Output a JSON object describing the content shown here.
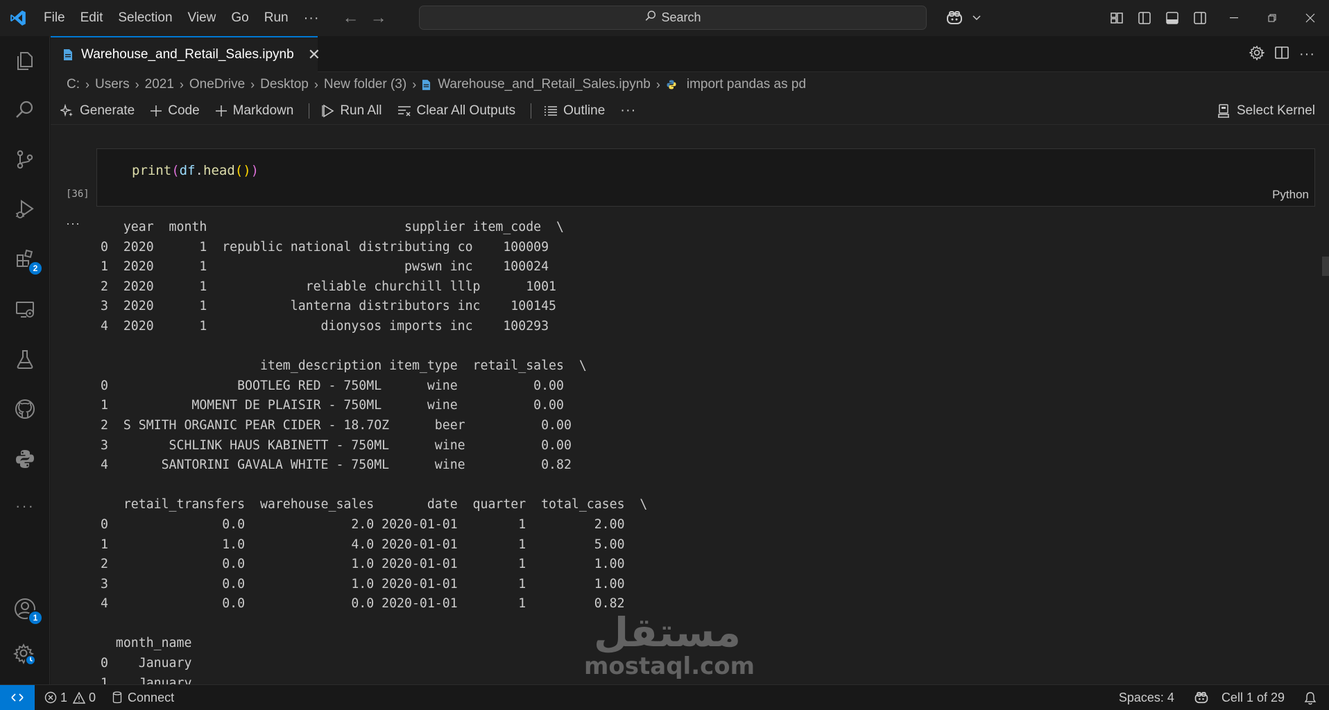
{
  "titlebar": {
    "menus": [
      "File",
      "Edit",
      "Selection",
      "View",
      "Go",
      "Run"
    ],
    "more": "···",
    "back": "←",
    "forward": "→",
    "search_label": "Search"
  },
  "tab": {
    "label": "Warehouse_and_Retail_Sales.ipynb",
    "close": "✕"
  },
  "breadcrumb": [
    "C:",
    "Users",
    "2021",
    "OneDrive",
    "Desktop",
    "New folder (3)",
    "Warehouse_and_Retail_Sales.ipynb",
    "import pandas as pd"
  ],
  "toolbar": {
    "generate": "Generate",
    "code": "Code",
    "markdown": "Markdown",
    "run_all": "Run All",
    "clear_outputs": "Clear All Outputs",
    "outline": "Outline",
    "more": "···",
    "select_kernel": "Select Kernel"
  },
  "cell": {
    "code": {
      "fn": "print",
      "p1": "(",
      "var": "df",
      "dot": ".",
      "method": "head",
      "p2": "()",
      "p3": ")"
    },
    "language": "Python",
    "execution_count": "[36]",
    "output_more": "···",
    "output": "   year  month                          supplier item_code  \\\n0  2020      1  republic national distributing co    100009   \n1  2020      1                          pwswn inc    100024   \n2  2020      1             reliable churchill lllp      1001   \n3  2020      1           lanterna distributors inc    100145   \n4  2020      1               dionysos imports inc    100293   \n\n                     item_description item_type  retail_sales  \\\n0                 BOOTLEG RED - 750ML      wine          0.00   \n1           MOMENT DE PLAISIR - 750ML      wine          0.00   \n2  S SMITH ORGANIC PEAR CIDER - 18.7OZ      beer          0.00   \n3        SCHLINK HAUS KABINETT - 750ML      wine          0.00   \n4       SANTORINI GAVALA WHITE - 750ML      wine          0.82   \n\n   retail_transfers  warehouse_sales       date  quarter  total_cases  \\\n0               0.0              2.0 2020-01-01        1         2.00   \n1               1.0              4.0 2020-01-01        1         5.00   \n2               0.0              1.0 2020-01-01        1         1.00   \n3               0.0              1.0 2020-01-01        1         1.00   \n4               0.0              0.0 2020-01-01        1         0.82   \n\n  month_name  \n0    January  \n1    January  "
  },
  "statusbar": {
    "errors": "1",
    "warnings": "0",
    "connect": "Connect",
    "spaces": "Spaces: 4",
    "cell_position": "Cell 1 of 29"
  },
  "activitybar": {
    "extensions_badge": "2",
    "accounts_badge": "1",
    "more": "···"
  },
  "watermark": {
    "arabic": "مستقل",
    "latin": "mostaql.com"
  },
  "colors": {
    "accent": "#0078d4",
    "background": "#1f1f1f",
    "sidebar": "#181818"
  }
}
